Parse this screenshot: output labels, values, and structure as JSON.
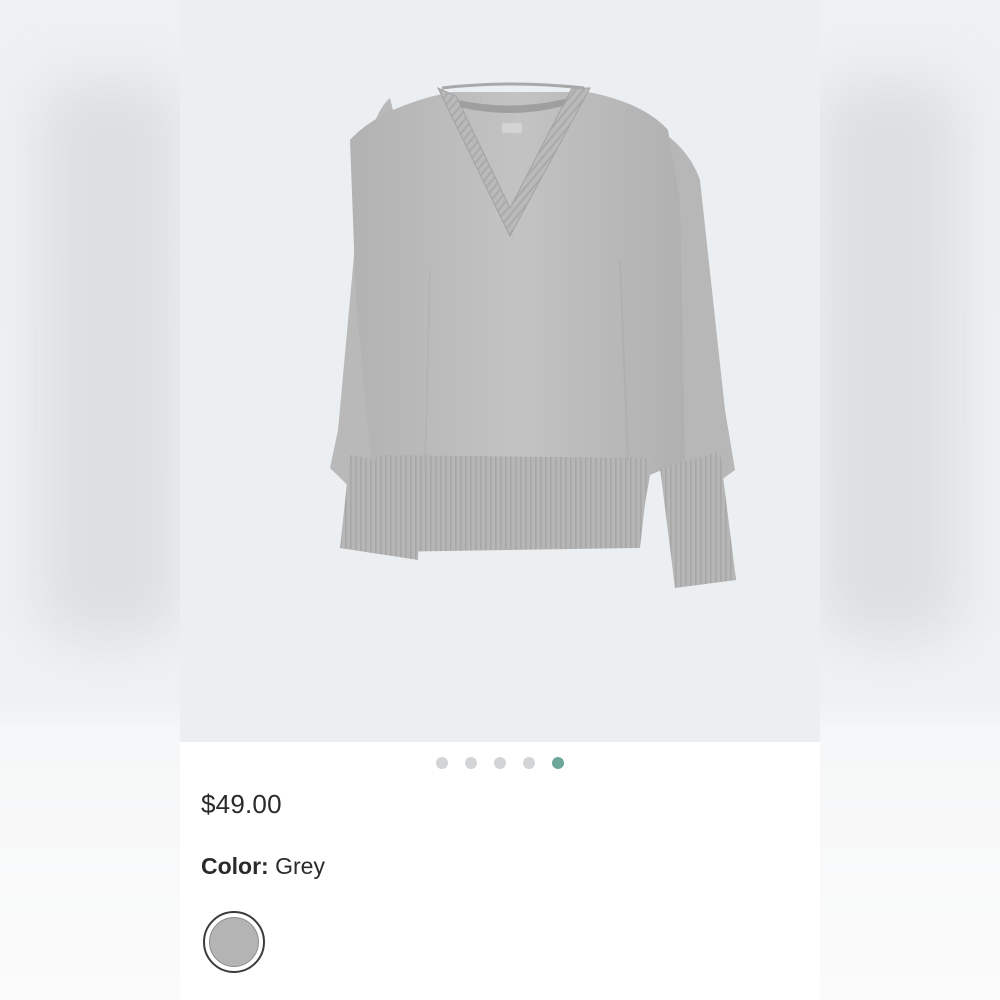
{
  "product": {
    "price": "$49.00",
    "color_label": "Color:",
    "color_value": "Grey",
    "swatch_color": "#b4b4b4",
    "garment_color": "#bdbdbd"
  },
  "carousel": {
    "slide_count": 5,
    "active_index": 4,
    "active_color": "#6fa69a",
    "inactive_color": "#d2d4d6"
  }
}
